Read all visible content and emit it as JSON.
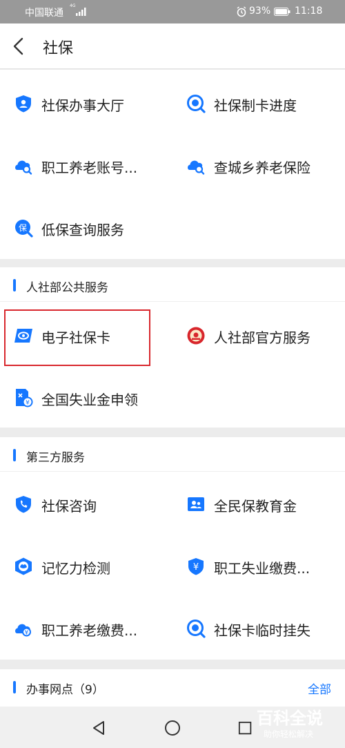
{
  "status_bar": {
    "carrier": "中国联通",
    "network": "4G",
    "battery": "93%",
    "time": "11:18"
  },
  "header": {
    "title": "社保"
  },
  "top_services": [
    {
      "label": "社保办事大厅",
      "icon": "shield-person-icon"
    },
    {
      "label": "社保制卡进度",
      "icon": "card-progress-icon"
    },
    {
      "label": "职工养老账号...",
      "icon": "cloud-search-icon"
    },
    {
      "label": "查城乡养老保险",
      "icon": "cloud-search-icon"
    },
    {
      "label": "低保查询服务",
      "icon": "bao-search-icon"
    }
  ],
  "public_section": {
    "title": "人社部公共服务",
    "items": [
      {
        "label": "电子社保卡",
        "icon": "social-card-icon"
      },
      {
        "label": "人社部官方服务",
        "icon": "ministry-emblem-icon"
      },
      {
        "label": "全国失业金申领",
        "icon": "unemployment-doc-icon"
      }
    ]
  },
  "third_party_section": {
    "title": "第三方服务",
    "items": [
      {
        "label": "社保咨询",
        "icon": "shield-phone-icon"
      },
      {
        "label": "全民保教育金",
        "icon": "family-card-icon"
      },
      {
        "label": "记忆力检测",
        "icon": "memory-shield-icon"
      },
      {
        "label": "职工失业缴费...",
        "icon": "yuan-shield-icon"
      },
      {
        "label": "职工养老缴费...",
        "icon": "cloud-yuan-icon"
      },
      {
        "label": "社保卡临时挂失",
        "icon": "card-report-icon"
      }
    ]
  },
  "office_section": {
    "title": "办事网点（9）",
    "link": "全部"
  },
  "watermark": {
    "title": "百科全说",
    "subtitle": "助你轻松解决"
  },
  "colors": {
    "accent": "#1677ff",
    "highlight": "#d8262c",
    "status_bar": "#999999"
  }
}
